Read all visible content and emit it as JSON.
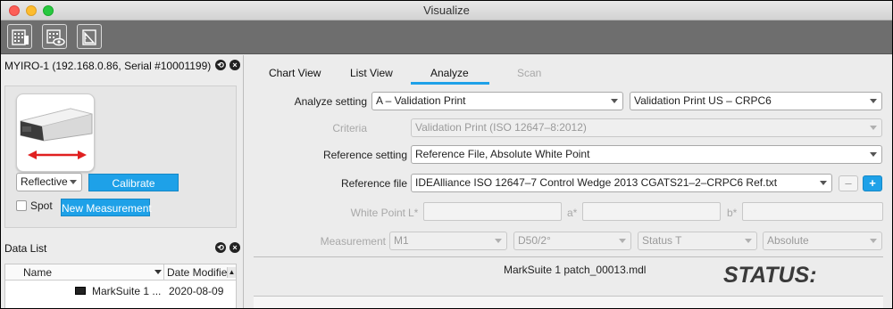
{
  "window": {
    "title": "Visualize"
  },
  "toolbar": {
    "icons": [
      "device-grid-icon",
      "eye-grid-icon",
      "ruler-icon"
    ]
  },
  "device_panel": {
    "title": "MYIRO-1 (192.168.0.86, Serial #10001199)",
    "mode_value": "Reflective",
    "calibrate_label": "Calibrate",
    "spot_label": "Spot",
    "new_measurement_label": "New Measurement"
  },
  "data_list": {
    "title": "Data List",
    "columns": [
      "Name",
      "Date Modifie"
    ],
    "rows": [
      {
        "name": "MarkSuite 1 ...",
        "date": "2020-08-09"
      }
    ]
  },
  "tabs": [
    {
      "label": "Chart View",
      "active": false,
      "disabled": false
    },
    {
      "label": "List View",
      "active": false,
      "disabled": false
    },
    {
      "label": "Analyze",
      "active": true,
      "disabled": false
    },
    {
      "label": "Scan",
      "active": false,
      "disabled": true
    }
  ],
  "analyze": {
    "analyze_setting_label": "Analyze setting",
    "analyze_setting_value": "A – Validation Print",
    "analyze_target_value": "Validation Print US – CRPC6",
    "criteria_label": "Criteria",
    "criteria_value": "Validation Print (ISO 12647–8:2012)",
    "reference_setting_label": "Reference setting",
    "reference_setting_value": "Reference File, Absolute White Point",
    "reference_file_label": "Reference file",
    "reference_file_value": "IDEAlliance ISO 12647–7 Control Wedge 2013 CGATS21–2–CRPC6 Ref.txt",
    "minus_label": "–",
    "plus_label": "+",
    "white_point_label": "White Point",
    "l_label": "L*",
    "a_label": "a*",
    "b_label": "b*",
    "measurement_label": "Measurement",
    "measurement_values": [
      "M1",
      "D50/2°",
      "Status T",
      "Absolute"
    ],
    "file_name": "MarkSuite 1 patch_00013.mdl",
    "status_label": "STATUS:"
  },
  "colors": {
    "accent": "#1ea1e8",
    "tab_underline": "#1ea1e8",
    "toolbar_bg": "#6e6e6e"
  }
}
